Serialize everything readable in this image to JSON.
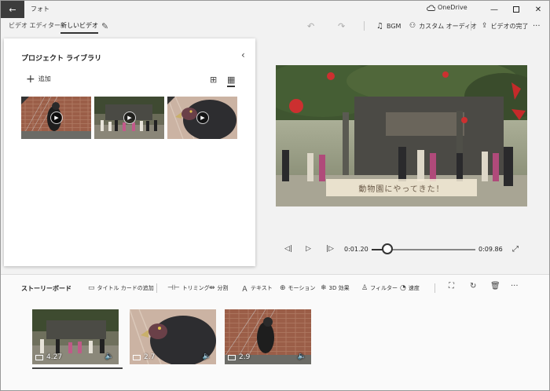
{
  "app": {
    "title": "フォト",
    "onedrive": "OneDrive"
  },
  "breadcrumb": {
    "parent": "ビデオ エディター",
    "current": "新しいビデオ"
  },
  "toolbar": {
    "bgm": "BGM",
    "custom_audio": "カスタム オーディオ",
    "finish_video": "ビデオの完了"
  },
  "library": {
    "title": "プロジェクト ライブラリ",
    "add": "追加"
  },
  "preview": {
    "caption": "動物園にやってきた！"
  },
  "player": {
    "current_time": "0:01.20",
    "total_time": "0:09.86",
    "progress": 0.12
  },
  "storyboard": {
    "title": "ストーリーボード",
    "actions": {
      "title_card": "タイトル カードの追加",
      "trim": "トリミング",
      "split": "分割",
      "text": "テキスト",
      "motion": "モーション",
      "effects_3d": "3D 効果",
      "filter": "フィルター",
      "speed": "速度"
    },
    "clips": [
      {
        "duration": "4.27"
      },
      {
        "duration": "2.7"
      },
      {
        "duration": "2.9"
      }
    ]
  },
  "icons": {
    "back": "back-arrow-icon",
    "cloud": "cloud-icon",
    "edit": "pencil-icon",
    "undo": "undo-icon",
    "redo": "redo-icon",
    "music": "music-note-icon",
    "audio": "person-audio-icon",
    "export": "export-icon",
    "more": "more-icon"
  }
}
